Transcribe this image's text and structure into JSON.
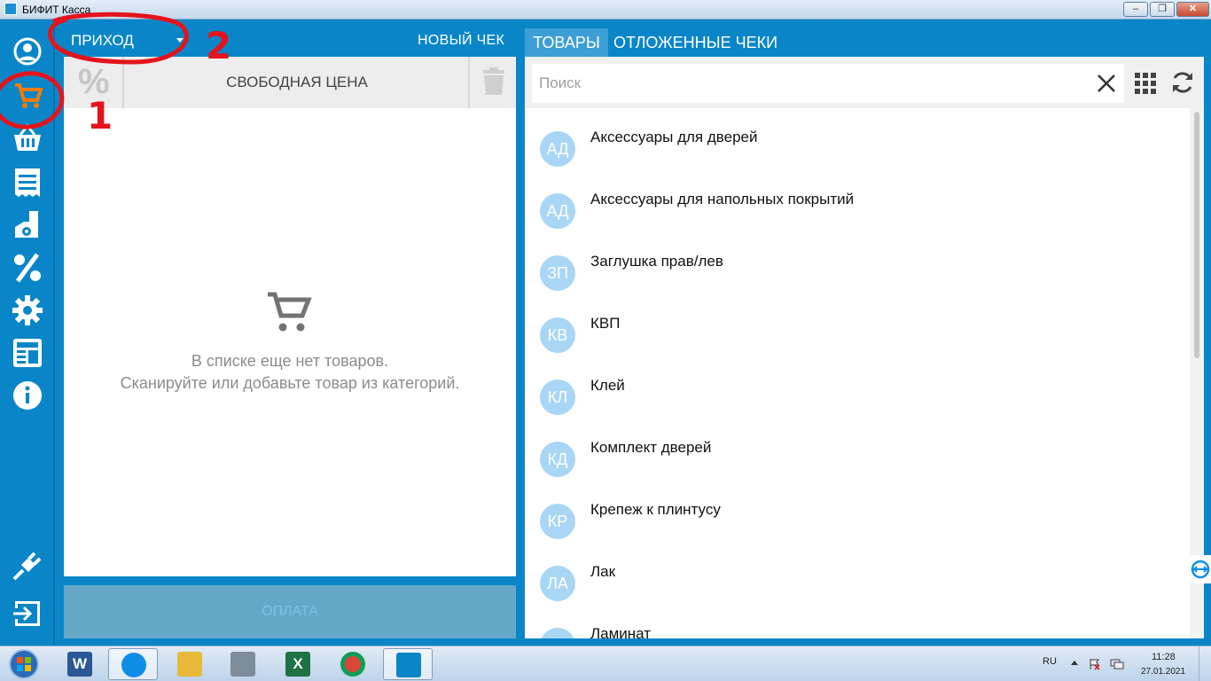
{
  "window": {
    "title": "БИФИТ Касса",
    "min_label": "–",
    "max_label": "❐",
    "close_label": "✕"
  },
  "sidebar": {
    "items": [
      {
        "icon": "account-icon"
      },
      {
        "icon": "cart-icon",
        "active": true
      },
      {
        "icon": "basket-icon"
      },
      {
        "icon": "receipts-icon"
      },
      {
        "icon": "cash-settings-icon"
      },
      {
        "icon": "discount-icon"
      },
      {
        "icon": "gear-icon"
      },
      {
        "icon": "news-icon"
      },
      {
        "icon": "info-icon"
      },
      {
        "icon": "plug-icon"
      },
      {
        "icon": "logout-icon"
      }
    ],
    "active_color": "#f57c00"
  },
  "check": {
    "operation": "ПРИХОД",
    "new_check_label": "НОВЫЙ ЧЕК",
    "discount_symbol": "%",
    "free_price_label": "СВОБОДНАЯ ЦЕНА",
    "empty_line1": "В списке еще нет товаров.",
    "empty_line2": "Сканируйте или добавьте товар из категорий.",
    "pay_label": "ОПЛАТА"
  },
  "catalog": {
    "tabs": [
      {
        "label": "ТОВАРЫ",
        "active": true
      },
      {
        "label": "ОТЛОЖЕННЫЕ ЧЕКИ",
        "active": false
      }
    ],
    "search_placeholder": "Поиск",
    "items": [
      {
        "initials": "АД",
        "name": "Аксессуары для дверей"
      },
      {
        "initials": "АД",
        "name": "Аксессуары для напольных покрытий"
      },
      {
        "initials": "ЗП",
        "name": "Заглушка прав/лев"
      },
      {
        "initials": "КВ",
        "name": "КВП"
      },
      {
        "initials": "КЛ",
        "name": "Клей"
      },
      {
        "initials": "КД",
        "name": "Комплект дверей"
      },
      {
        "initials": "КР",
        "name": "Крепеж к плинтусу"
      },
      {
        "initials": "ЛА",
        "name": "Лак"
      },
      {
        "initials": "ЛА",
        "name": "Ламинат"
      }
    ]
  },
  "annotations": {
    "label1": "1",
    "label2": "2",
    "color": "#e4141c"
  },
  "taskbar": {
    "apps": [
      {
        "icon": "word-icon",
        "glyph": "W",
        "color": "#2b5797"
      },
      {
        "icon": "teamviewer-icon",
        "glyph": "",
        "color": "#0e8ee9",
        "active": true
      },
      {
        "icon": "explorer-icon",
        "glyph": "",
        "color": "#e8b93a"
      },
      {
        "icon": "calculator-icon",
        "glyph": "",
        "color": "#7e8c9a"
      },
      {
        "icon": "excel-icon",
        "glyph": "X",
        "color": "#1f7244"
      },
      {
        "icon": "chrome-icon",
        "glyph": "",
        "color": "#db4437"
      },
      {
        "icon": "bifit-icon",
        "glyph": "",
        "color": "#0a86c8",
        "active": true
      }
    ],
    "lang": "RU",
    "time": "11:28",
    "date": "27.01.2021"
  }
}
